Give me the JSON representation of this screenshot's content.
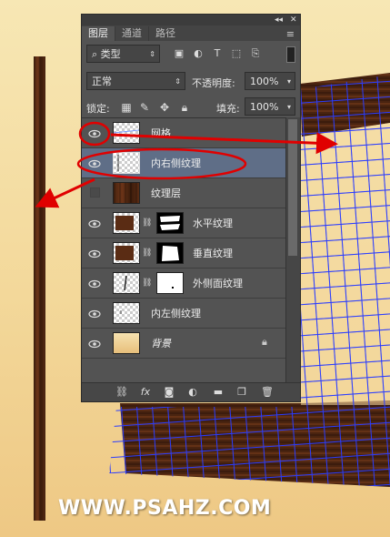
{
  "panel": {
    "collapse": "◂◂",
    "close": "✕",
    "tabs": [
      "图层",
      "通道",
      "路径"
    ],
    "menu_icon": "≡",
    "filter_kind": "类型",
    "filter_icon": "search-icon",
    "blend_mode": "正常",
    "opacity_label": "不透明度:",
    "opacity_value": "100%",
    "lock_label": "锁定:",
    "fill_label": "填充:",
    "fill_value": "100%"
  },
  "layers": [
    {
      "name": "网格",
      "visible": true
    },
    {
      "name": "内右侧纹理",
      "visible": true,
      "selected": true
    },
    {
      "name": "纹理层",
      "visible": false
    },
    {
      "name": "水平纹理",
      "visible": true,
      "masked": true
    },
    {
      "name": "垂直纹理",
      "visible": true,
      "masked": true
    },
    {
      "name": "外侧面纹理",
      "visible": true,
      "masked": true
    },
    {
      "name": "内左侧纹理",
      "visible": true
    },
    {
      "name": "背景",
      "visible": true,
      "locked": true
    }
  ],
  "footer_icons": [
    "link-icon",
    "fx-icon",
    "mask-icon",
    "adjustment-icon",
    "folder-icon",
    "new-layer-icon",
    "trash-icon"
  ],
  "watermark": "WWW.PSAHZ.COM",
  "colors": {
    "annotation": "#e00000",
    "grid": "#2a3cff",
    "panel": "#535353"
  }
}
